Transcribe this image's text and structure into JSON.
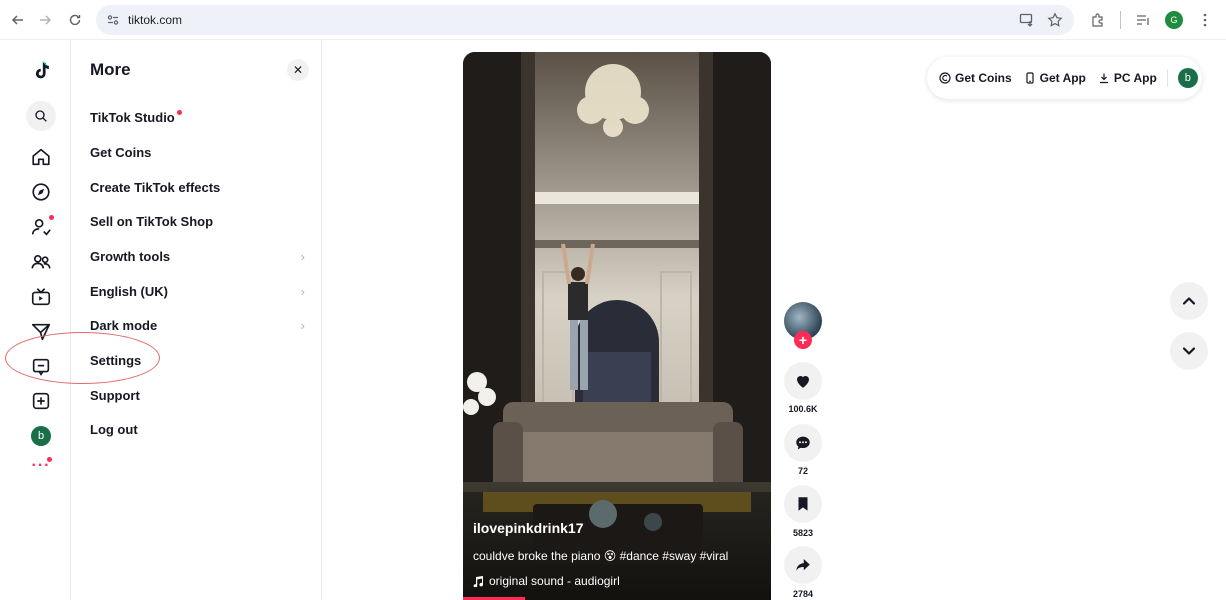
{
  "browser": {
    "url": "tiktok.com",
    "profile_initial": "G"
  },
  "rail": {
    "avatar_initial": "b",
    "more_dots": "···"
  },
  "panel": {
    "title": "More",
    "close": "✕",
    "items": [
      {
        "label": "TikTok Studio"
      },
      {
        "label": "Get Coins"
      },
      {
        "label": "Create TikTok effects"
      },
      {
        "label": "Sell on TikTok Shop"
      },
      {
        "label": "Growth tools"
      },
      {
        "label": "English (UK)"
      },
      {
        "label": "Dark mode"
      },
      {
        "label": "Settings"
      },
      {
        "label": "Support"
      },
      {
        "label": "Log out"
      }
    ],
    "chevron": "›"
  },
  "video": {
    "username": "ilovepinkdrink17",
    "caption": "couldve broke the piano 😵 #dance #sway #viral",
    "sound": "original sound - audiogirl",
    "progress": 0.2
  },
  "actions": {
    "follow": "+",
    "likes": "100.6K",
    "comments": "72",
    "saves": "5823",
    "shares": "2784"
  },
  "topbar": {
    "get_coins": "Get Coins",
    "get_app": "Get App",
    "pc_app": "PC App",
    "avatar_initial": "b"
  },
  "colors": {
    "accent": "#fe2c55",
    "annotation": "#e46a6a"
  }
}
